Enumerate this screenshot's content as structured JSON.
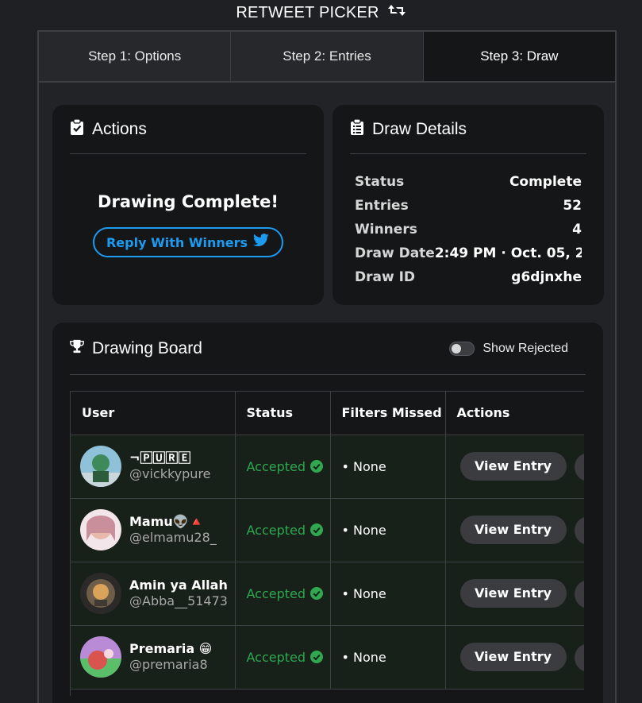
{
  "app": {
    "title": "RETWEET PICKER"
  },
  "tabs": [
    {
      "label": "Step 1: Options",
      "active": false
    },
    {
      "label": "Step 2: Entries",
      "active": false
    },
    {
      "label": "Step 3: Draw",
      "active": true
    }
  ],
  "actions": {
    "title": "Actions",
    "message": "Drawing Complete!",
    "reply_label": "Reply With Winners"
  },
  "details": {
    "title": "Draw Details",
    "rows": [
      {
        "label": "Status",
        "value": "Complete"
      },
      {
        "label": "Entries",
        "value": "52"
      },
      {
        "label": "Winners",
        "value": "4"
      },
      {
        "label": "Draw Date",
        "value": "2:49 PM · Oct. 05, 2"
      },
      {
        "label": "Draw ID",
        "value": "g6djnxhe"
      }
    ]
  },
  "board": {
    "title": "Drawing Board",
    "toggle_label": "Show Rejected",
    "columns": [
      "User",
      "Status",
      "Filters Missed",
      "Actions"
    ],
    "rows": [
      {
        "name": "¬🄿🅄🅁🄴",
        "handle": "@vickkypure",
        "status": "Accepted",
        "filters": "• None",
        "action": "View Entry"
      },
      {
        "name": "Mamu👽🔺",
        "handle": "@elmamu28_",
        "status": "Accepted",
        "filters": "• None",
        "action": "View Entry"
      },
      {
        "name": "Amin ya Allah",
        "handle": "@Abba__51473",
        "status": "Accepted",
        "filters": "• None",
        "action": "View Entry"
      },
      {
        "name": "Premaria 😁",
        "handle": "@premaria8",
        "status": "Accepted",
        "filters": "• None",
        "action": "View Entry"
      }
    ]
  },
  "colors": {
    "accent": "#1d9bf0",
    "accepted": "#2fa84f",
    "row_bg": "#172019"
  }
}
